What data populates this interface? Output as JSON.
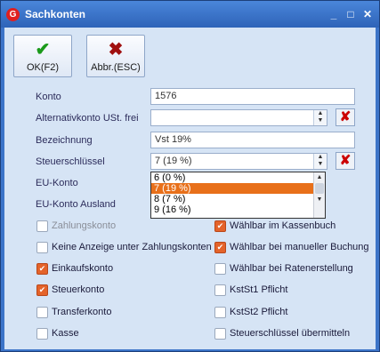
{
  "window": {
    "title": "Sachkonten",
    "minimize": "_",
    "maximize": "□",
    "close": "✕",
    "app_icon": "G"
  },
  "toolbar": {
    "ok": {
      "icon": "check-icon",
      "glyph": "✔",
      "label": "OK(F2)",
      "color": "#1b9a1b"
    },
    "cancel": {
      "icon": "cross-icon",
      "glyph": "✖",
      "label": "Abbr.(ESC)",
      "color": "#a01010"
    }
  },
  "form": {
    "konto": {
      "label": "Konto",
      "value": "1576"
    },
    "alternativkonto": {
      "label": "Alternativkonto  USt. frei",
      "value": ""
    },
    "bezeichnung": {
      "label": "Bezeichnung",
      "value": "Vst 19%"
    },
    "steuerschluessel": {
      "label": "Steuerschlüssel",
      "value": "7 (19 %)"
    },
    "eu_konto": {
      "label": "EU-Konto"
    },
    "eu_konto_ausland": {
      "label": "EU-Konto Ausland"
    },
    "delete_glyph": "✘"
  },
  "dropdown": {
    "options": [
      "6 (0 %)",
      "7 (19 %)",
      "8 (7 %)",
      "9 (16 %)"
    ],
    "selected": "7 (19 %)"
  },
  "checkboxes": {
    "left": [
      {
        "label": "Zahlungskonto",
        "checked": false,
        "disabled": true
      },
      {
        "label": "Keine Anzeige unter Zahlungskonten",
        "checked": false,
        "disabled": false
      },
      {
        "label": "Einkaufskonto",
        "checked": true,
        "disabled": false
      },
      {
        "label": "Steuerkonto",
        "checked": true,
        "disabled": false
      },
      {
        "label": "Transferkonto",
        "checked": false,
        "disabled": false
      },
      {
        "label": "Kasse",
        "checked": false,
        "disabled": false
      }
    ],
    "right": [
      {
        "label": "Wählbar im Kassenbuch",
        "checked": true,
        "disabled": false
      },
      {
        "label": "Wählbar bei manueller Buchung",
        "checked": true,
        "disabled": false
      },
      {
        "label": "Wählbar bei Ratenerstellung",
        "checked": false,
        "disabled": false
      },
      {
        "label": "KstSt1 Pflicht",
        "checked": false,
        "disabled": false
      },
      {
        "label": "KstSt2 Pflicht",
        "checked": false,
        "disabled": false
      },
      {
        "label": "Steuerschlüssel übermitteln",
        "checked": false,
        "disabled": false
      }
    ]
  },
  "colors": {
    "accent": "#e4632a",
    "titlebar": "#3c74c8",
    "panel": "#d6e4f5"
  }
}
